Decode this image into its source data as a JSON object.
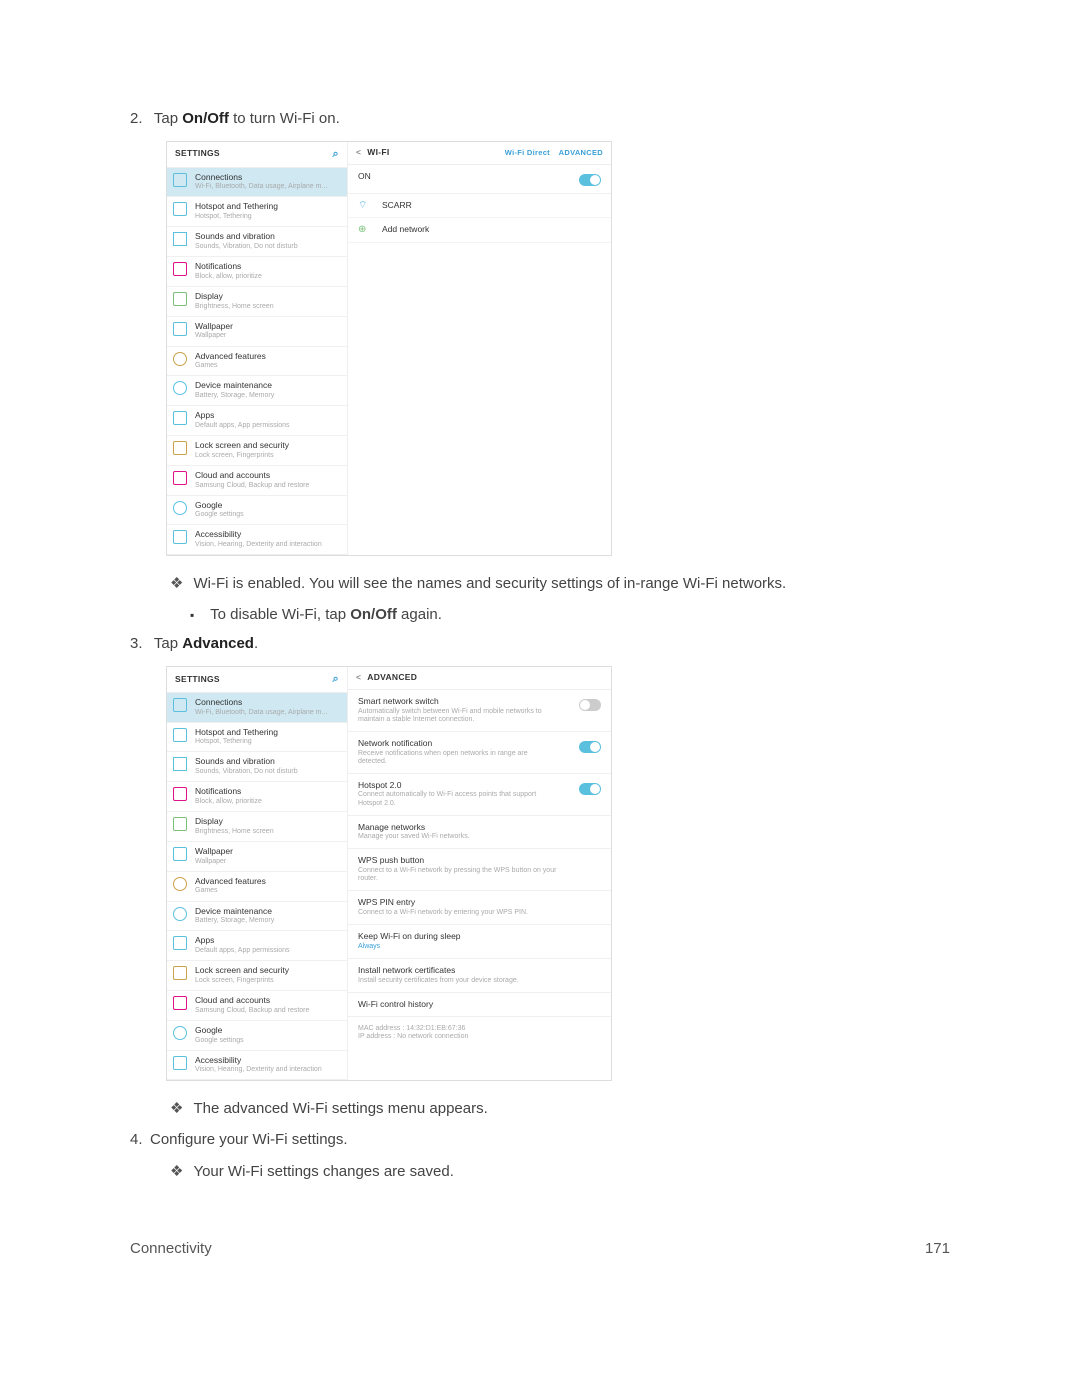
{
  "steps": {
    "s2_pre": "Tap ",
    "s2_bold": "On/Off",
    "s2_post": " to turn Wi-Fi on.",
    "s3_pre": "Tap ",
    "s3_bold": "Advanced",
    "s3_post": ".",
    "s4": "Configure your Wi-Fi settings."
  },
  "notes": {
    "wifi_enabled": "Wi-Fi is enabled. You will see the names and security settings of in-range Wi-Fi networks.",
    "disable_pre": "To disable Wi-Fi, tap ",
    "disable_bold": "On/Off",
    "disable_post": " again.",
    "adv_appears": "The advanced Wi-Fi settings menu appears.",
    "saved": "Your Wi-Fi settings changes are saved."
  },
  "footer": {
    "section": "Connectivity",
    "page": "171"
  },
  "settings_sidebar": {
    "title": "SETTINGS",
    "items": [
      {
        "t": "Connections",
        "s": "Wi-Fi, Bluetooth, Data usage, Airplane m..."
      },
      {
        "t": "Hotspot and Tethering",
        "s": "Hotspot, Tethering"
      },
      {
        "t": "Sounds and vibration",
        "s": "Sounds, Vibration, Do not disturb"
      },
      {
        "t": "Notifications",
        "s": "Block, allow, prioritize"
      },
      {
        "t": "Display",
        "s": "Brightness, Home screen"
      },
      {
        "t": "Wallpaper",
        "s": "Wallpaper"
      },
      {
        "t": "Advanced features",
        "s": "Games"
      },
      {
        "t": "Device maintenance",
        "s": "Battery, Storage, Memory"
      },
      {
        "t": "Apps",
        "s": "Default apps, App permissions"
      },
      {
        "t": "Lock screen and security",
        "s": "Lock screen, Fingerprints"
      },
      {
        "t": "Cloud and accounts",
        "s": "Samsung Cloud, Backup and restore"
      },
      {
        "t": "Google",
        "s": "Google settings"
      },
      {
        "t": "Accessibility",
        "s": "Vision, Hearing, Dexterity and interaction"
      }
    ]
  },
  "wifi_panel": {
    "title": "WI-FI",
    "direct": "Wi-Fi Direct",
    "advanced": "ADVANCED",
    "on_label": "ON",
    "net1": "SCARR",
    "add": "Add network"
  },
  "advanced_panel": {
    "title": "ADVANCED",
    "items": [
      {
        "t": "Smart network switch",
        "s": "Automatically switch between Wi-Fi and mobile networks to maintain a stable Internet connection.",
        "toggle": "off"
      },
      {
        "t": "Network notification",
        "s": "Receive notifications when open networks in range are detected.",
        "toggle": "on"
      },
      {
        "t": "Hotspot 2.0",
        "s": "Connect automatically to Wi-Fi access points that support Hotspot 2.0.",
        "toggle": "on"
      },
      {
        "t": "Manage networks",
        "s": "Manage your saved Wi-Fi networks."
      },
      {
        "t": "WPS push button",
        "s": "Connect to a Wi-Fi network by pressing the WPS button on your router."
      },
      {
        "t": "WPS PIN entry",
        "s": "Connect to a Wi-Fi network by entering your WPS PIN."
      },
      {
        "t": "Keep Wi-Fi on during sleep",
        "s": "Always",
        "blue": true
      },
      {
        "t": "Install network certificates",
        "s": "Install security certificates from your device storage."
      },
      {
        "t": "Wi-Fi control history",
        "s": ""
      },
      {
        "t": "",
        "s": "MAC address : 14:32:D1:EB:67:36\nIP address : No network connection"
      }
    ]
  }
}
